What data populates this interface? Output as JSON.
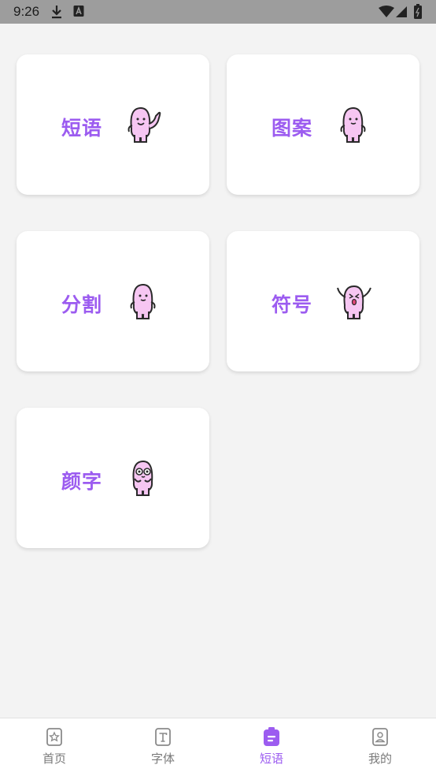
{
  "status_bar": {
    "time": "9:26",
    "icons": [
      "download-icon",
      "notification-a-icon",
      "wifi-icon",
      "signal-icon",
      "battery-icon"
    ]
  },
  "cards": [
    {
      "label": "短语",
      "mascot": "waving-mascot-icon"
    },
    {
      "label": "图案",
      "mascot": "mascot-icon"
    },
    {
      "label": "分割",
      "mascot": "mascot-icon"
    },
    {
      "label": "符号",
      "mascot": "cheering-mascot-icon"
    },
    {
      "label": "颜字",
      "mascot": "glasses-mascot-icon"
    }
  ],
  "tabbar": {
    "tabs": [
      {
        "label": "首页",
        "icon": "home-star-icon",
        "active": false
      },
      {
        "label": "字体",
        "icon": "font-icon",
        "active": false
      },
      {
        "label": "短语",
        "icon": "phrase-icon",
        "active": true
      },
      {
        "label": "我的",
        "icon": "profile-icon",
        "active": false
      }
    ]
  },
  "colors": {
    "accent": "#9c5cf0",
    "mascot_fill": "#f6c6f2",
    "background": "#f3f3f3",
    "status_bar": "#9d9d9d"
  }
}
